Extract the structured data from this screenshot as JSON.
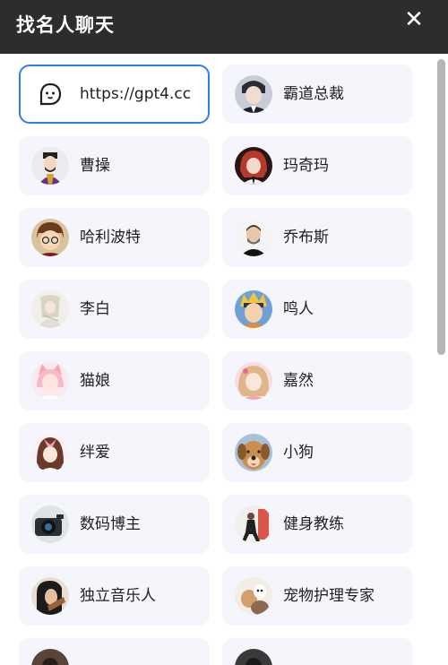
{
  "dialog": {
    "title": "找名人聊天",
    "close_icon": "close-icon"
  },
  "cards": [
    {
      "label": "https://gpt4.cc",
      "icon": "chat-bot-icon",
      "selected": true
    },
    {
      "label": "霸道总裁",
      "icon": "avatar-ceo"
    },
    {
      "label": "曹操",
      "icon": "avatar-caocao"
    },
    {
      "label": "玛奇玛",
      "icon": "avatar-makima"
    },
    {
      "label": "哈利波特",
      "icon": "avatar-harry-potter"
    },
    {
      "label": "乔布斯",
      "icon": "avatar-steve-jobs"
    },
    {
      "label": "李白",
      "icon": "avatar-libai"
    },
    {
      "label": "鸣人",
      "icon": "avatar-naruto"
    },
    {
      "label": "猫娘",
      "icon": "avatar-catgirl"
    },
    {
      "label": "嘉然",
      "icon": "avatar-jiaran"
    },
    {
      "label": "绊爱",
      "icon": "avatar-kizuna-ai"
    },
    {
      "label": "小狗",
      "icon": "avatar-puppy"
    },
    {
      "label": "数码博主",
      "icon": "avatar-tech-blogger"
    },
    {
      "label": "健身教练",
      "icon": "avatar-fitness-coach"
    },
    {
      "label": "独立音乐人",
      "icon": "avatar-indie-musician"
    },
    {
      "label": "宠物护理专家",
      "icon": "avatar-pet-care-expert"
    }
  ]
}
